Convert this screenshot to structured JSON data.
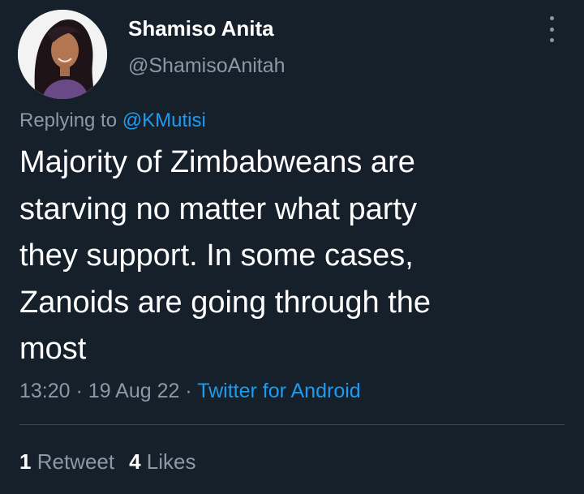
{
  "author": {
    "display_name": "Shamiso Anita",
    "handle": "@ShamisoAnitah"
  },
  "reply": {
    "prefix": "Replying to",
    "mention": "@KMutisi"
  },
  "tweet": {
    "lines": [
      "Majority of Zimbabweans are",
      "starving no matter what party",
      "they support. In some cases,",
      "Zanoids are going through the",
      "most"
    ]
  },
  "meta": {
    "time": "13:20",
    "separator": "·",
    "date": "19 Aug 22",
    "source": "Twitter for Android"
  },
  "stats": {
    "retweets_count": "1",
    "retweets_label": "Retweet",
    "likes_count": "4",
    "likes_label": "Likes"
  },
  "colors": {
    "background": "#15202b",
    "text_primary": "#ffffff",
    "text_secondary": "#8b98a5",
    "accent": "#1d9bf0",
    "divider": "#38444d"
  },
  "icons": {
    "more": "more-vertical-icon"
  }
}
